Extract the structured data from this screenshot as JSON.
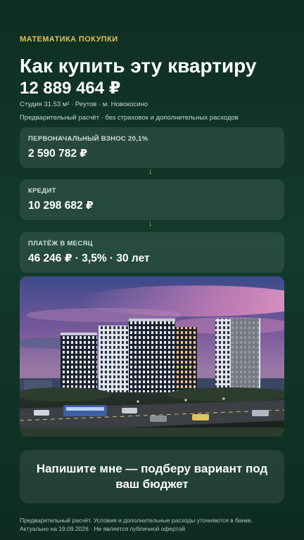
{
  "kicker": "МАТЕМАТИКА ПОКУПКИ",
  "title": "Как купить эту квартиру",
  "price": "12 889 464 ₽",
  "meta": "Студия 31.53 м² · Реутов · м. Новокосино",
  "note": "Предварительный расчёт · без страховок и дополнительных расходов",
  "cards": [
    {
      "label": "ПЕРВОНАЧАЛЬНЫЙ ВЗНОС 20,1%",
      "value": "2 590 782 ₽"
    },
    {
      "label": "КРЕДИТ",
      "value": "10 298 682 ₽"
    },
    {
      "label": "ПЛАТЁЖ В МЕСЯЦ",
      "value": "46 246 ₽ · 3,5% · 30 лет"
    }
  ],
  "arrow_glyph": "↓",
  "cta": "Напишите мне — подберу вариант под ваш бюджет",
  "footer": {
    "line1": "Предварительный расчёт. Условия и дополнительные расходы уточняются в банке.",
    "line2": "Актуально на 19.09.2026 · Не является публичной офертой"
  },
  "colors": {
    "accent": "#e2c15a",
    "background": "#123a2b"
  }
}
